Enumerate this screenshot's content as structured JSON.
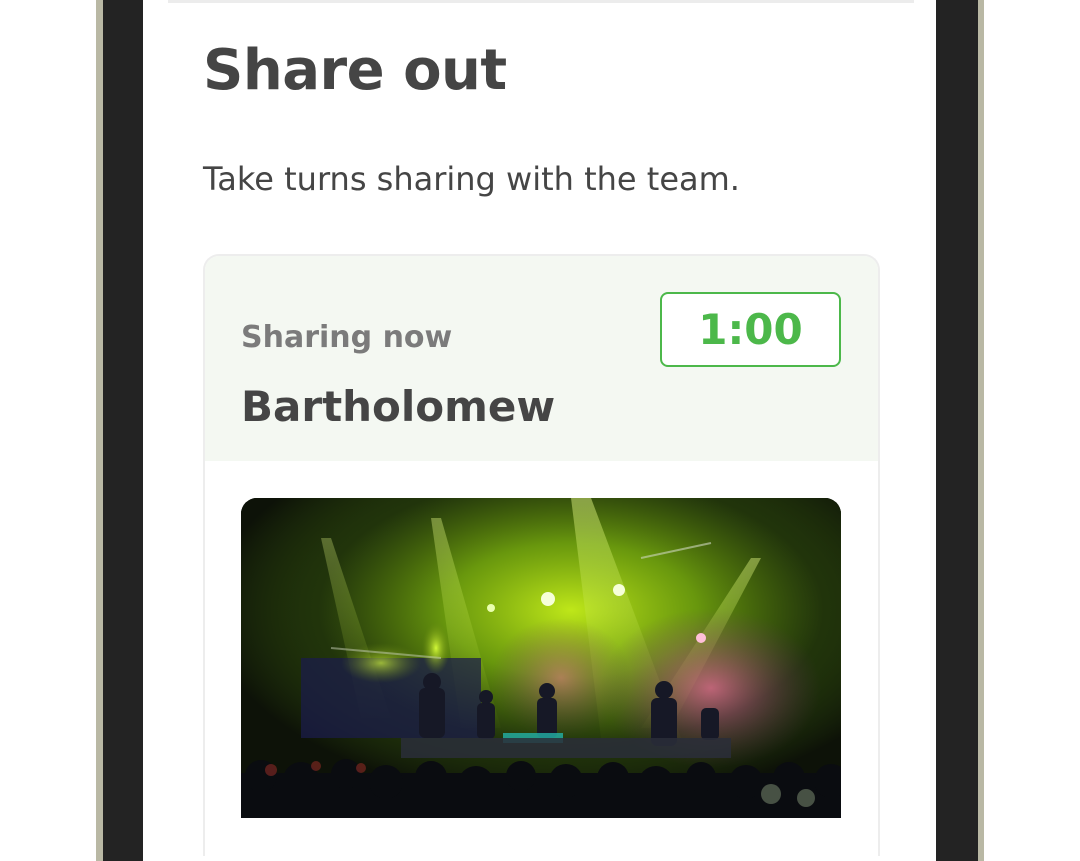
{
  "page": {
    "title": "Share out",
    "subtitle": "Take turns sharing with the team."
  },
  "share_card": {
    "status_label": "Sharing now",
    "presenter_name": "Bartholomew",
    "timer": "1:00"
  },
  "photo": {
    "subject": "concert-stage-photo"
  },
  "colors": {
    "accent": "#4cb84a",
    "text_primary": "#454545",
    "text_secondary": "#7b7b7b",
    "card_header_bg": "#f4f8f2",
    "device_bezel": "#232323"
  }
}
